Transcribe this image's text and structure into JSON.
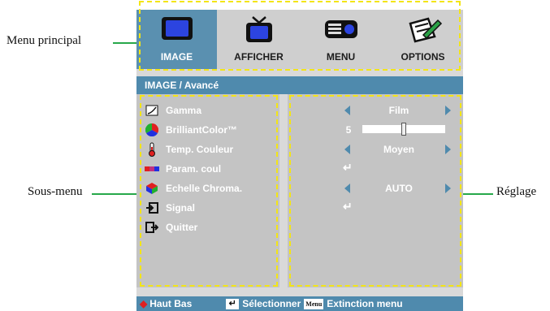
{
  "callouts": {
    "menu_principal": "Menu principal",
    "sous_menu": "Sous-menu",
    "reglage": "Réglage"
  },
  "tabs": [
    {
      "label": "IMAGE",
      "icon": "monitor-icon",
      "active": true
    },
    {
      "label": "AFFICHER",
      "icon": "tv-icon",
      "active": false
    },
    {
      "label": "MENU",
      "icon": "projector-icon",
      "active": false
    },
    {
      "label": "OPTIONS",
      "icon": "pencil-notepad-icon",
      "active": false
    }
  ],
  "header": "IMAGE / Avancé",
  "menu_items": [
    {
      "label": "Gamma",
      "icon": "gamma-icon"
    },
    {
      "label": "BrilliantColor™",
      "icon": "color-wheel-icon"
    },
    {
      "label": "Temp. Couleur",
      "icon": "thermometer-icon"
    },
    {
      "label": "Param. coul",
      "icon": "color-bar-icon"
    },
    {
      "label": "Echelle Chroma.",
      "icon": "cube-icon"
    },
    {
      "label": "Signal",
      "icon": "signal-input-icon"
    },
    {
      "label": "Quitter",
      "icon": "exit-icon"
    }
  ],
  "settings": {
    "gamma": "Film",
    "brilliantcolor_value": "5",
    "brilliantcolor_level": 0.5,
    "temp_couleur": "Moyen",
    "echelle_chroma": "AUTO"
  },
  "footer": {
    "nav": "Haut Bas",
    "select": "Sélectionner",
    "menu_key": "Menu",
    "exit": "Extinction menu"
  },
  "colors": {
    "accent": "#4f8aad",
    "tab_active": "#5a90b0",
    "dash": "#f3e516",
    "callout_line": "#27a84a"
  }
}
